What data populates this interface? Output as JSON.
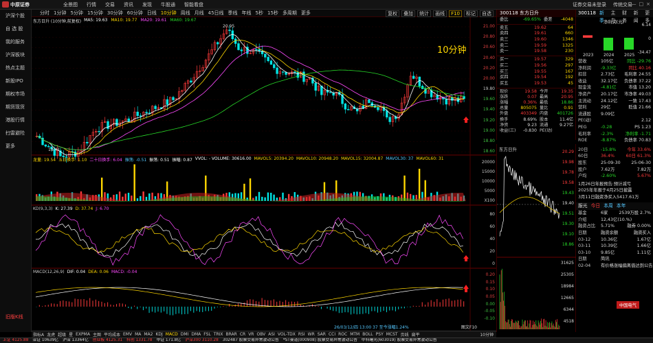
{
  "app": {
    "logo_text": "中原证券",
    "menu": [
      "全景图",
      "行情",
      "交易",
      "资讯",
      "发现",
      "牛股通",
      "智能看盘"
    ],
    "top_right": [
      "证券交易未登录",
      "传统交易"
    ],
    "window_btns": [
      "—",
      "□",
      "×"
    ]
  },
  "sidebar": {
    "items": [
      "沪深个股",
      "自 选 股",
      "我的服务",
      "沪深板块",
      "热点主题",
      "新股IPO",
      "期权市场",
      "期货现货",
      "港股行情",
      "扫雷避险",
      "更多"
    ],
    "bottom": "旧版K线"
  },
  "period_bar": {
    "items": [
      "分时",
      "1分钟",
      "5分钟",
      "15分钟",
      "30分钟",
      "60分钟",
      "日线",
      "周线",
      "月线",
      "45日线",
      "季线",
      "年线",
      "5秒",
      "15秒",
      "多周期",
      "更多"
    ],
    "active": "10分钟",
    "tools": [
      "复权",
      "叠加",
      "统计",
      "画线",
      "F10",
      "标记",
      "自选"
    ]
  },
  "kline": {
    "title": "东方日升 (10分钟,前复权)",
    "ma": [
      {
        "label": "MA5: 19.63",
        "color": "#ffffff"
      },
      {
        "label": "MA10: 19.77",
        "color": "#ffd700"
      },
      {
        "label": "MA20: 19.61",
        "color": "#ff4bff"
      },
      {
        "label": "MA60: 19.67",
        "color": "#28d828"
      }
    ],
    "high_label": "20.95",
    "low_label": "18.41",
    "axis": [
      "21.00",
      "20.80",
      "20.60",
      "20.40",
      "20.20",
      "20.00",
      "19.80",
      "19.60",
      "19.40",
      "19.20",
      "19.00",
      "18.80",
      "18.60"
    ],
    "period_overlay": "10分钟"
  },
  "volume": {
    "line": [
      {
        "t": "龙量: 19.54",
        "c": "#ffd700"
      },
      {
        "t": "五日换手: 1.10",
        "c": "#ffd700"
      },
      {
        "t": "二十日换手: 6.04",
        "c": "#ff4bff"
      },
      {
        "t": "振荡: -0.51",
        "c": "#55c8ff"
      },
      {
        "t": "振荡: 0.51",
        "c": "#ffffff"
      },
      {
        "t": "振幅: 0.87",
        "c": "#ffffff"
      },
      {
        "t": "VVOL: - VOLUME: 30616.00",
        "c": "#ffffff"
      },
      {
        "t": "MAVOL5: 20394.20",
        "c": "#ffd700"
      },
      {
        "t": "MAVOL10: 20948.20",
        "c": "#ffd700"
      },
      {
        "t": "MAVOL15: 32004.87",
        "c": "#ffd700"
      },
      {
        "t": "MAVOL30: 37",
        "c": "#55c8ff"
      },
      {
        "t": "MAVOL60: 31",
        "c": "#ffd700"
      }
    ],
    "axis": [
      "20000",
      "15000",
      "10000",
      "5000",
      "X100"
    ]
  },
  "kdj": {
    "line": [
      {
        "t": "KD(9,3,3)",
        "c": "#c8c8c8"
      },
      {
        "t": "K: 27.39",
        "c": "#ffffff"
      },
      {
        "t": "D: 37.74",
        "c": "#ffd700"
      },
      {
        "t": "J: 6.70",
        "c": "#ff4bff"
      }
    ],
    "axis": [
      "80",
      "60",
      "40",
      "20",
      "0"
    ]
  },
  "macd": {
    "line": [
      {
        "t": "MACD(12,26,9)",
        "c": "#c8c8c8"
      },
      {
        "t": "DIF: 0.04",
        "c": "#ffffff"
      },
      {
        "t": "DEA: 0.06",
        "c": "#ffd700"
      },
      {
        "t": "MACD: -0.04",
        "c": "#ff4bff"
      }
    ],
    "axis": [
      "0.20",
      "0.15",
      "0.10",
      "0.05",
      "0.00",
      "-0.05",
      "-0.10"
    ],
    "footer": "图文F10",
    "hint": "26/03/12/四 13:00 37 至今涨幅1.24%"
  },
  "indicator_tabs": {
    "items": [
      "指标A",
      "龙虎",
      "超级",
      "星",
      "EXPMA",
      "主图",
      "平均成本",
      "EMV",
      "MA",
      "MA2",
      "KDJ",
      "MACD",
      "DMI",
      "DMA",
      "FSL",
      "TRIX",
      "BRAR",
      "CR",
      "VR",
      "OBV",
      "ASI",
      "VOL-TDX",
      "RSI",
      "WR",
      "SAR",
      "CCI",
      "ROC",
      "MTM",
      "BOLL",
      "PSY",
      "MCST",
      "页线",
      "扁平"
    ],
    "active": "MACD",
    "period": "10分钟"
  },
  "orderbook": {
    "code": "300118",
    "name": "东方日升",
    "weibi": {
      "k": "委比",
      "p": "-69.65%",
      "k2": "委差",
      "v": "-4048"
    },
    "sells": [
      {
        "k": "卖五",
        "p": "19.62",
        "v": "64"
      },
      {
        "k": "卖四",
        "p": "19.61",
        "v": "660"
      },
      {
        "k": "卖三",
        "p": "19.60",
        "v": "1346"
      },
      {
        "k": "卖二",
        "p": "19.59",
        "v": "1325"
      },
      {
        "k": "卖一",
        "p": "19.58",
        "v": "230"
      }
    ],
    "buys": [
      {
        "k": "买一",
        "p": "19.57",
        "v": "329"
      },
      {
        "k": "买二",
        "p": "19.56",
        "v": "297"
      },
      {
        "k": "买三",
        "p": "19.55",
        "v": "167"
      },
      {
        "k": "买四",
        "p": "19.54",
        "v": "192"
      },
      {
        "k": "买五",
        "p": "19.53",
        "v": "45"
      }
    ],
    "quotes": [
      {
        "a": "现价",
        "b": "19.58",
        "bc": "red",
        "c": "今开",
        "d": "19.35",
        "dc": "red"
      },
      {
        "a": "涨跌",
        "b": "0.07",
        "bc": "red",
        "c": "最高",
        "d": "20.95",
        "dc": "red"
      },
      {
        "a": "涨幅",
        "b": "0.36%",
        "bc": "red",
        "c": "最低",
        "d": "18.86",
        "dc": "green"
      },
      {
        "a": "总量",
        "b": "805075",
        "bc": "yel",
        "c": "量比",
        "d": "0.91",
        "dc": "yel"
      },
      {
        "a": "外盘",
        "b": "403349",
        "bc": "red",
        "c": "内盘",
        "d": "401726",
        "dc": "green"
      },
      {
        "a": "换手",
        "b": "8.69%",
        "bc": "wht",
        "c": "股本",
        "d": "11.4亿",
        "dc": "wht"
      },
      {
        "a": "净资",
        "b": "9.23",
        "bc": "wht",
        "c": "流通",
        "d": "9.27亿",
        "dc": "wht"
      },
      {
        "a": "收益(三)",
        "b": "-0.830",
        "bc": "wht",
        "c": "PE(动)",
        "d": "",
        "dc": "wht"
      }
    ]
  },
  "intraday": {
    "title": "东方日升",
    "axis": [
      "20.29",
      "19.98",
      "19.78",
      "19.58",
      "19.43",
      "19.40",
      "19.51",
      "19.30",
      "19.10",
      "18.86"
    ],
    "vol_axis": [
      "31625",
      "25305",
      "18984",
      "12665",
      "6344",
      "4518"
    ]
  },
  "info": {
    "header": [
      "300118",
      "新季",
      "主力",
      "财务",
      "新闻",
      "更多"
    ],
    "bar_title": "净利润(元)",
    "bars": [
      {
        "y": "2023",
        "v": 6.14
      },
      {
        "y": "2024",
        "v": -32
      },
      {
        "y": "2025",
        "v": -29.76
      }
    ],
    "bar_axis": [
      "6.14",
      "0",
      "-34.47"
    ],
    "rows": [
      {
        "l": "营收",
        "m": "105亿",
        "mc": "wht",
        "r": "同比 -29.76",
        "rc": "green"
      },
      {
        "l": "净利润",
        "m": "-9.33亿",
        "mc": "green",
        "r": "同比 40.16",
        "rc": "red"
      },
      {
        "l": "扣非",
        "m": "2.73亿",
        "mc": "wht",
        "r": "毛利率 24.55",
        "rc": "wht"
      },
      {
        "l": "收益",
        "m": "32.17亿",
        "mc": "wht",
        "r": "负债率 37.22",
        "rc": "wht"
      },
      {
        "l": "现金流",
        "m": "-4.81亿",
        "mc": "green",
        "r": "市值 13.20",
        "rc": "wht"
      },
      {
        "l": "净资产",
        "m": "20.17亿",
        "mc": "wht",
        "r": "市净率 49.03",
        "rc": "wht"
      },
      {
        "l": "主流动",
        "m": "24.12亿",
        "mc": "wht",
        "r": "一致 17.43",
        "rc": "wht"
      },
      {
        "l": "营利",
        "m": "29亿",
        "mc": "wht",
        "r": "贬值 21.66",
        "rc": "wht"
      },
      {
        "l": "流通股",
        "m": "9.09亿",
        "mc": "wht",
        "r": "",
        "rc": "wht"
      },
      {
        "l": "PE(动)",
        "m": "",
        "mc": "wht",
        "r": "2.12",
        "rc": "wht"
      },
      {
        "l": "PEG",
        "m": "-0.28",
        "mc": "green",
        "r": "PS 1.23",
        "rc": "wht"
      },
      {
        "l": "毛利率",
        "m": "-2.3%",
        "mc": "green",
        "r": "净利率 -1.71",
        "rc": "green"
      },
      {
        "l": "ROE",
        "m": "-8.87%",
        "mc": "green",
        "r": "负债率 70.83",
        "rc": "wht"
      }
    ],
    "perf": [
      {
        "l": "20日",
        "m": "-15.8%",
        "mc": "green",
        "r": "今年 33.6%",
        "rc": "red"
      },
      {
        "l": "60日",
        "m": "36.4%",
        "mc": "red",
        "r": "60日 61.3%",
        "rc": "red"
      },
      {
        "l": "股东",
        "m": "25-09-30",
        "mc": "wht",
        "r": "25-06-30",
        "rc": "wht"
      },
      {
        "l": "股户",
        "m": "7.62万",
        "mc": "wht",
        "r": "7.82万",
        "rc": "wht"
      },
      {
        "l": "户均",
        "m": "-2.60%",
        "mc": "green",
        "r": "5.67%",
        "rc": "red"
      }
    ],
    "notices": [
      "1月26日年报预告:预计减亏",
      "2025年年报于4月25日披露",
      "3月11日融资净买入5417.61万"
    ],
    "tabs": [
      "服光",
      "今日",
      "本周",
      "本年"
    ],
    "sector": [
      {
        "l": "基金",
        "m": "6家",
        "mc": "wht",
        "r": "2539万股 2.7%",
        "rc": "wht"
      },
      {
        "l": "介绍",
        "m": "12,43亿(10.%)",
        "mc": "wht",
        "r": "",
        "rc": "wht"
      },
      {
        "l": "融资占比",
        "m": "5.71%",
        "mc": "wht",
        "r": "融券 0.00%",
        "rc": "wht"
      }
    ],
    "margin_hdr": {
      "l": "日期",
      "m": "融资余额",
      "r": "融资买入"
    },
    "margin": [
      {
        "l": "03-12",
        "m": "10.36亿",
        "r": "1.67亿"
      },
      {
        "l": "03-11",
        "m": "10.39亿",
        "r": "1.66亿"
      },
      {
        "l": "03-10",
        "m": "9.85亿",
        "r": "1.11亿"
      }
    ],
    "news": [
      {
        "l": "日期",
        "m": "简讯"
      },
      {
        "l": "02-04",
        "m": "有价格涨幅偏离值达到公告"
      }
    ],
    "badge": "中国电气"
  },
  "status": [
    {
      "t": "上证 4125.88",
      "c": "red"
    },
    {
      "t": "深证 10639亿",
      "c": "wht"
    },
    {
      "t": "沪深 13364亿",
      "c": "wht"
    },
    {
      "t": "创业板 4125.31",
      "c": "red"
    },
    {
      "t": "科创 1331.78",
      "c": "red"
    },
    {
      "t": "中证 171.8亿",
      "c": "wht"
    },
    {
      "t": "沪深300 3110.28",
      "c": "red"
    },
    {
      "t": "302487 股票交易异常波动公告",
      "c": "wht"
    },
    {
      "t": "*ST曼道(000908) 股票交易异常波动公告",
      "c": "wht"
    },
    {
      "t": "中科曙光(603019) 股票交易异常波动公告",
      "c": "wht"
    }
  ]
}
